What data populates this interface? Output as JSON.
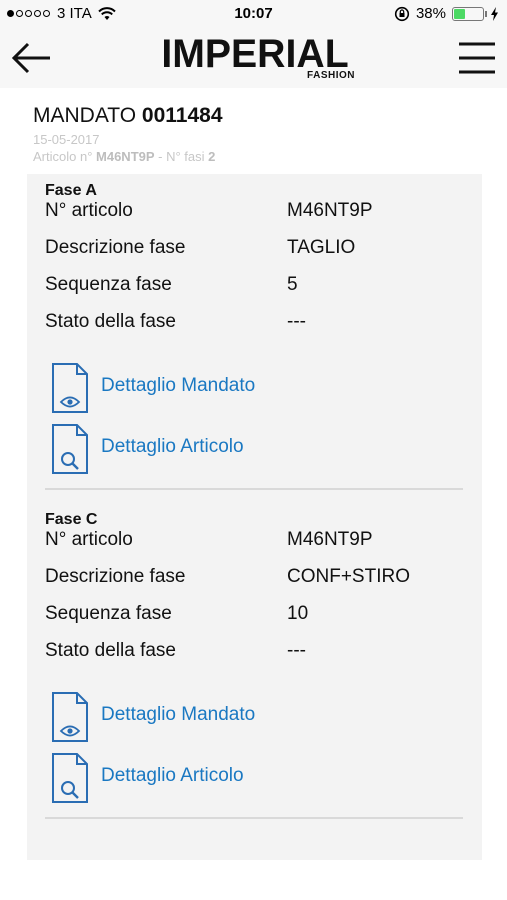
{
  "status": {
    "carrier": "3 ITA",
    "time": "10:07",
    "battery_percent_text": "38%",
    "battery_level": 0.38
  },
  "nav": {
    "brand": "IMPERIAL",
    "brand_sub": "FASHION"
  },
  "header": {
    "mandato_label": "MANDATO",
    "mandato_number": "0011484",
    "date": "15-05-2017",
    "articolo_label": "Articolo n°",
    "articolo_code": "M46NT9P",
    "fasi_label": "- N° fasi",
    "fasi_count": "2"
  },
  "fasi": [
    {
      "title": "Fase A",
      "rows": [
        {
          "label": "N° articolo",
          "value": "M46NT9P"
        },
        {
          "label": "Descrizione fase",
          "value": "TAGLIO"
        },
        {
          "label": "Sequenza fase",
          "value": "5"
        },
        {
          "label": "Stato della fase",
          "value": "---"
        }
      ],
      "link_mandato": "Dettaglio Mandato",
      "link_articolo": "Dettaglio Articolo"
    },
    {
      "title": "Fase C",
      "rows": [
        {
          "label": "N° articolo",
          "value": "M46NT9P"
        },
        {
          "label": "Descrizione fase",
          "value": "CONF+STIRO"
        },
        {
          "label": "Sequenza fase",
          "value": "10"
        },
        {
          "label": "Stato della fase",
          "value": "---"
        }
      ],
      "link_mandato": "Dettaglio Mandato",
      "link_articolo": "Dettaglio Articolo"
    }
  ],
  "colors": {
    "link": "#1a78c2",
    "panel_bg": "#f3f3f3",
    "muted": "#c7c7c7",
    "battery": "#4cd964"
  }
}
